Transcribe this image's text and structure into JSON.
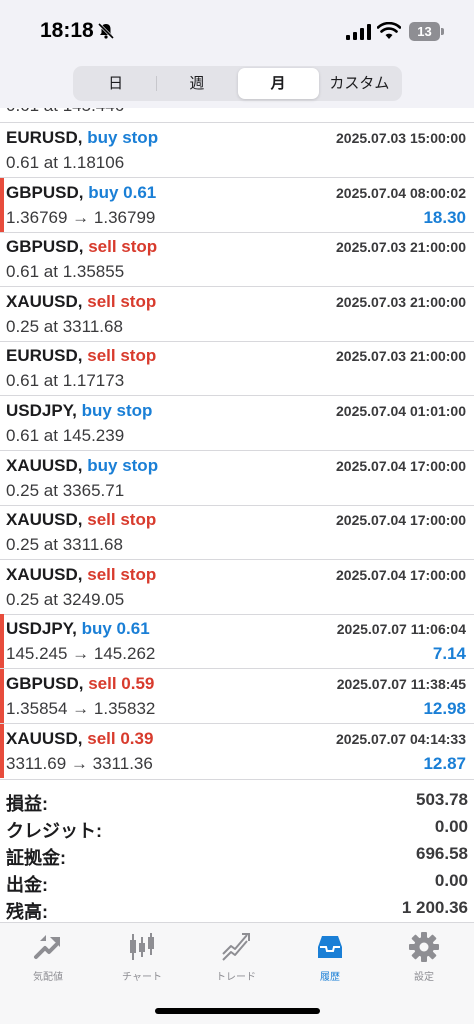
{
  "status_bar": {
    "time": "18:18",
    "battery": "13"
  },
  "segmented": [
    {
      "label": "日",
      "active": false
    },
    {
      "label": "週",
      "active": false
    },
    {
      "label": "月",
      "active": true
    },
    {
      "label": "カスタム",
      "active": false
    }
  ],
  "partial_row": "0.61 at 145.446",
  "orders": [
    {
      "symbol": "EURUSD,",
      "type": "buy stop",
      "type_color": "buy",
      "date": "2025.07.03 15:00:00",
      "detail": "0.61 at 1.18106",
      "profit": "",
      "deal": false
    },
    {
      "symbol": "GBPUSD,",
      "type": "buy 0.61",
      "type_color": "buy",
      "date": "2025.07.04 08:00:02",
      "detail": "1.36769 → 1.36799",
      "profit": "18.30",
      "deal": true
    },
    {
      "symbol": "GBPUSD,",
      "type": "sell stop",
      "type_color": "sell",
      "date": "2025.07.03 21:00:00",
      "detail": "0.61 at 1.35855",
      "profit": "",
      "deal": false
    },
    {
      "symbol": "XAUUSD,",
      "type": "sell stop",
      "type_color": "sell",
      "date": "2025.07.03 21:00:00",
      "detail": "0.25 at 3311.68",
      "profit": "",
      "deal": false
    },
    {
      "symbol": "EURUSD,",
      "type": "sell stop",
      "type_color": "sell",
      "date": "2025.07.03 21:00:00",
      "detail": "0.61 at 1.17173",
      "profit": "",
      "deal": false
    },
    {
      "symbol": "USDJPY,",
      "type": "buy stop",
      "type_color": "buy",
      "date": "2025.07.04 01:01:00",
      "detail": "0.61 at 145.239",
      "profit": "",
      "deal": false
    },
    {
      "symbol": "XAUUSD,",
      "type": "buy stop",
      "type_color": "buy",
      "date": "2025.07.04 17:00:00",
      "detail": "0.25 at 3365.71",
      "profit": "",
      "deal": false
    },
    {
      "symbol": "XAUUSD,",
      "type": "sell stop",
      "type_color": "sell",
      "date": "2025.07.04 17:00:00",
      "detail": "0.25 at 3311.68",
      "profit": "",
      "deal": false
    },
    {
      "symbol": "XAUUSD,",
      "type": "sell stop",
      "type_color": "sell",
      "date": "2025.07.04 17:00:00",
      "detail": "0.25 at 3249.05",
      "profit": "",
      "deal": false
    },
    {
      "symbol": "USDJPY,",
      "type": "buy 0.61",
      "type_color": "buy",
      "date": "2025.07.07 11:06:04",
      "detail": "145.245 → 145.262",
      "profit": "7.14",
      "deal": true
    },
    {
      "symbol": "GBPUSD,",
      "type": "sell 0.59",
      "type_color": "sell",
      "date": "2025.07.07 11:38:45",
      "detail": "1.35854 → 1.35832",
      "profit": "12.98",
      "deal": true
    },
    {
      "symbol": "XAUUSD,",
      "type": "sell 0.39",
      "type_color": "sell",
      "date": "2025.07.07 04:14:33",
      "detail": "3311.69 → 3311.36",
      "profit": "12.87",
      "deal": true
    }
  ],
  "summary": [
    {
      "label": "損益:",
      "value": "503.78"
    },
    {
      "label": "クレジット:",
      "value": "0.00"
    },
    {
      "label": "証拠金:",
      "value": "696.58"
    },
    {
      "label": "出金:",
      "value": "0.00"
    },
    {
      "label": "残高:",
      "value": "1 200.36"
    }
  ],
  "tabs": [
    {
      "label": "気配値",
      "icon": "quotes-icon",
      "active": false
    },
    {
      "label": "チャート",
      "icon": "chart-icon",
      "active": false
    },
    {
      "label": "トレード",
      "icon": "trade-icon",
      "active": false
    },
    {
      "label": "履歴",
      "icon": "history-icon",
      "active": true
    },
    {
      "label": "設定",
      "icon": "settings-icon",
      "active": false
    }
  ],
  "colors": {
    "buy": "#1a7fd6",
    "sell": "#d83b2d",
    "deal_marker": "#e74c3c",
    "tab_active": "#1a7fd6",
    "tab_inactive": "#8e8e93"
  }
}
